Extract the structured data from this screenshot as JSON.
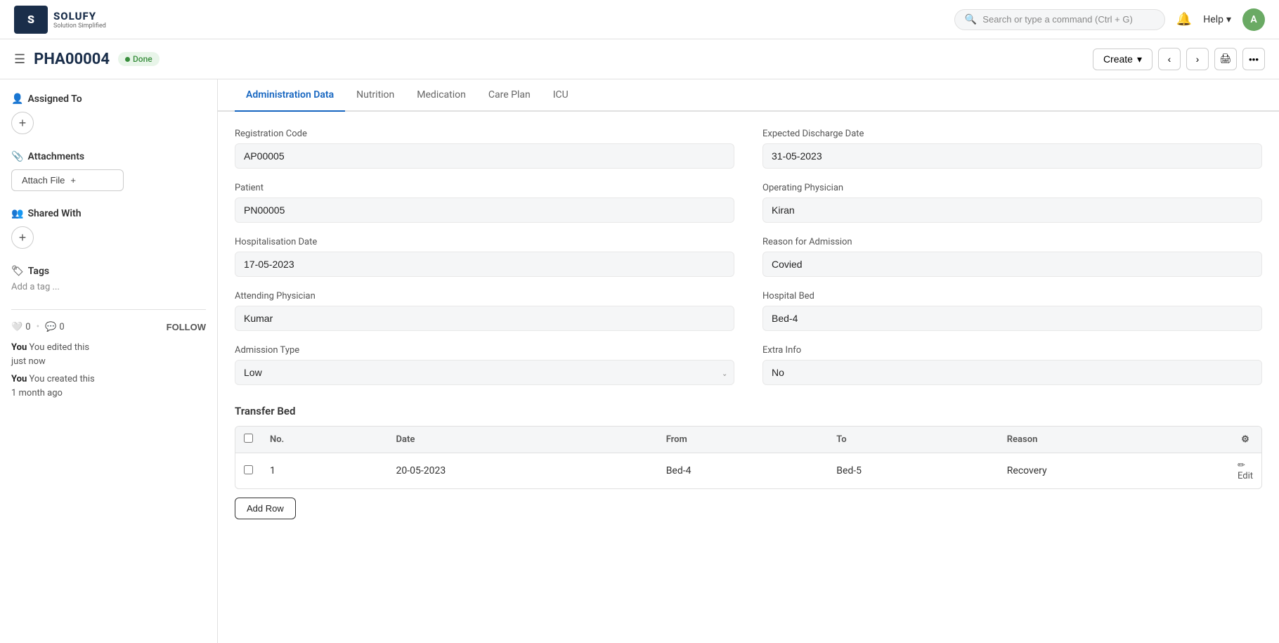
{
  "app": {
    "logo_letter": "S",
    "logo_title": "SOLUFY",
    "logo_subtitle": "Solution Simplified"
  },
  "header": {
    "search_placeholder": "Search or type a command (Ctrl + G)",
    "help_label": "Help",
    "avatar_letter": "A"
  },
  "page": {
    "title": "PHA00004",
    "status": "Done",
    "create_label": "Create",
    "menu_icon": "☰"
  },
  "sidebar": {
    "assigned_to_label": "Assigned To",
    "attachments_label": "Attachments",
    "attach_file_label": "Attach File",
    "shared_with_label": "Shared With",
    "tags_label": "Tags",
    "add_tag_placeholder": "Add a tag ...",
    "likes_count": "0",
    "comments_count": "0",
    "follow_label": "FOLLOW",
    "activity_1": "You edited this",
    "activity_1_time": "just now",
    "activity_2": "You created this",
    "activity_2_time": "1 month ago"
  },
  "tabs": [
    {
      "label": "Administration Data",
      "active": true
    },
    {
      "label": "Nutrition",
      "active": false
    },
    {
      "label": "Medication",
      "active": false
    },
    {
      "label": "Care Plan",
      "active": false
    },
    {
      "label": "ICU",
      "active": false
    }
  ],
  "form": {
    "registration_code_label": "Registration Code",
    "registration_code_value": "AP00005",
    "expected_discharge_label": "Expected Discharge Date",
    "expected_discharge_value": "31-05-2023",
    "patient_label": "Patient",
    "patient_value": "PN00005",
    "operating_physician_label": "Operating Physician",
    "operating_physician_value": "Kiran",
    "hospitalisation_date_label": "Hospitalisation Date",
    "hospitalisation_date_value": "17-05-2023",
    "reason_admission_label": "Reason for Admission",
    "reason_admission_value": "Covied",
    "attending_physician_label": "Attending Physician",
    "attending_physician_value": "Kumar",
    "hospital_bed_label": "Hospital Bed",
    "hospital_bed_value": "Bed-4",
    "admission_type_label": "Admission Type",
    "admission_type_value": "Low",
    "extra_info_label": "Extra Info",
    "extra_info_value": "No"
  },
  "transfer_bed": {
    "section_title": "Transfer Bed",
    "columns": [
      "No.",
      "Date",
      "From",
      "To",
      "Reason"
    ],
    "rows": [
      {
        "no": "1",
        "date": "20-05-2023",
        "from": "Bed-4",
        "to": "Bed-5",
        "reason": "Recovery"
      }
    ],
    "add_row_label": "Add Row",
    "edit_label": "Edit"
  }
}
